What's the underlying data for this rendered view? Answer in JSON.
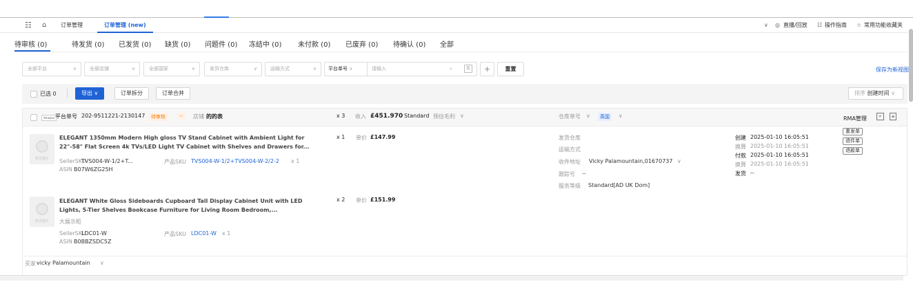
{
  "topbar": {
    "tabs": [
      {
        "label": "订单管理"
      },
      {
        "label": "订单管理 (new)"
      }
    ],
    "right_links": [
      {
        "label": "直播/回放"
      },
      {
        "label": "操作指南"
      },
      {
        "label": "常用功能收藏夹"
      }
    ]
  },
  "status_tabs": [
    {
      "label": "待审核 (0)"
    },
    {
      "label": "待发货 (0)"
    },
    {
      "label": "已发货 (0)"
    },
    {
      "label": "缺货 (0)"
    },
    {
      "label": "问题件 (0)"
    },
    {
      "label": "冻结中 (0)"
    },
    {
      "label": "未付款 (0)"
    },
    {
      "label": "已废弃 (0)"
    },
    {
      "label": "待确认 (0)"
    },
    {
      "label": "全部"
    }
  ],
  "filters": {
    "platform": "全部平台",
    "store": "全部店铺",
    "country": "全部国家",
    "warehouse": "发货仓库",
    "shipping": "运输方式",
    "order_type": "平台单号",
    "search_placeholder": "请输入",
    "reset_label": "重置",
    "save_view": "保存为新视图"
  },
  "action_bar": {
    "selected": "已选 0",
    "export": "导出",
    "split": "订单拆分",
    "merge": "订单合并",
    "sort_prefix": "排序",
    "sort_value": "创建时间"
  },
  "order": {
    "platform_logo": "Amazon",
    "platform_order_label": "平台单号",
    "platform_order_no": "202-9511221-2130147",
    "status": "待审核",
    "tag": "--",
    "store_label": "店铺",
    "store_name": "的的表",
    "qty": "x 3",
    "income_label": "收入",
    "income_value": "£451.970",
    "service": "Standard",
    "profit_label": "预估毛利",
    "warehouse_no_label": "仓库单号",
    "country": "英国",
    "rma_label": "RMA管理",
    "items": [
      {
        "title_line1": "ELEGANT 1350mm Modern High gloss TV Stand Cabinet with Ambient Light for",
        "title_line2": "22\"-58\" Flat Screen 4k TVs/LED Light TV Cabinet with Shelves and Drawers for...",
        "nickname": "",
        "seller_sku_label": "SellerSKU",
        "seller_sku": "TVS004-W-1/2+T...",
        "product_sku_label": "产品SKU",
        "product_sku": "TVS004-W-1/2+TVS004-W-2/2-2",
        "sku_qty": "x 1",
        "asin_label": "ASIN",
        "asin": "B07W6ZG25H",
        "qty": "x 1",
        "price_label": "单价",
        "price": "£147.99",
        "thumb_caption": "暂无图片"
      },
      {
        "title_line1": "ELEGANT White Gloss Sideboards Cupboard Tall Display Cabinet Unit with LED",
        "title_line2": "Lights, 5-Tier Shelves Bookcase Furniture for Living Room Bedroom,...",
        "nickname": "大展示柜",
        "seller_sku_label": "SellerSKU",
        "seller_sku": "LDC01-W",
        "product_sku_label": "产品SKU",
        "product_sku": "LDC01-W",
        "sku_qty": "x 1",
        "asin_label": "ASIN",
        "asin": "B0BBZSDC5Z",
        "qty": "x 2",
        "price_label": "单价",
        "price": "£151.99",
        "thumb_caption": "暂无图片"
      }
    ],
    "shipping_info": {
      "warehouse_label": "发货仓库",
      "method_label": "运输方式",
      "address_label": "收件地址",
      "address_value": "Vicky Palamountain,01670737",
      "tracking_label": "跟踪号",
      "tracking_value": "--",
      "service_label": "服务等级",
      "service_value": "Standard[AD UK Dom]"
    },
    "times": {
      "created_label": "创建",
      "created": "2025-01-10 16:05:51",
      "converted_label": "换算",
      "converted": "2025-01-10 16:05:51",
      "paid_label": "付款",
      "paid": "2025-01-10 16:05:51",
      "converted2_label": "换算",
      "converted2": "2025-01-10 16:05:51",
      "shipped_label": "发货",
      "shipped": "--"
    },
    "actions": [
      "重发单",
      "退件单",
      "退款单"
    ],
    "buyer_label": "买家",
    "buyer": "vicky Palamountain"
  }
}
